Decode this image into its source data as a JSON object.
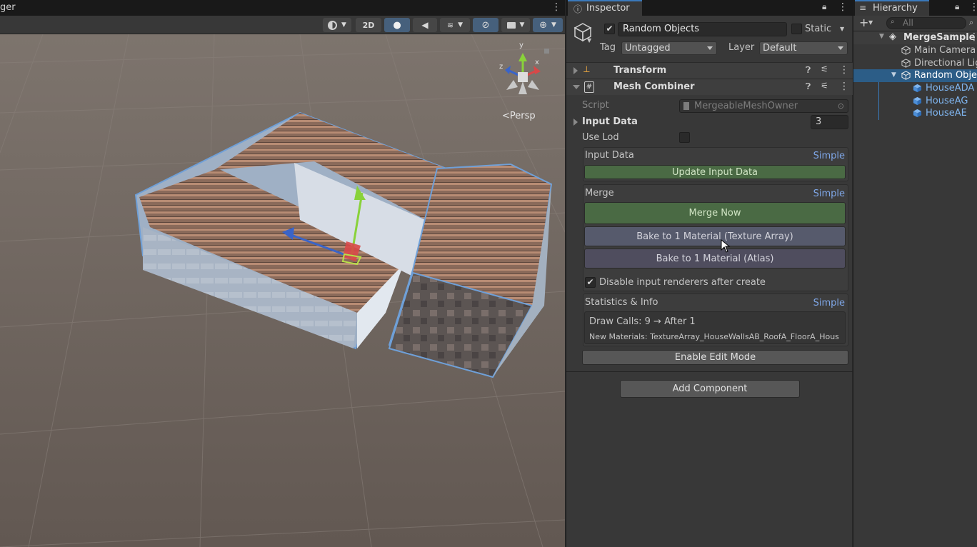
{
  "scene": {
    "tab_title": "ger",
    "toolbar": {
      "mode_2d": "2D"
    },
    "persp_label": "Persp",
    "gizmo_axes": {
      "y": "y",
      "x": "x",
      "z": "z"
    }
  },
  "inspector": {
    "tab_label": "Inspector",
    "object_name": "Random Objects",
    "active_checked": true,
    "static_label": "Static",
    "tag_label": "Tag",
    "tag_value": "Untagged",
    "layer_label": "Layer",
    "layer_value": "Default",
    "components": {
      "transform": "Transform",
      "mesh_combiner": "Mesh Combiner"
    },
    "script_label": "Script",
    "script_value": "MergeableMeshOwner",
    "input_data_label": "Input Data",
    "input_data_count": "3",
    "use_lod_label": "Use Lod",
    "sections": {
      "input_data": {
        "title": "Input Data",
        "simple": "Simple",
        "button": "Update Input Data"
      },
      "merge": {
        "title": "Merge",
        "simple": "Simple",
        "merge_now": "Merge Now",
        "bake_texture_array": "Bake to 1 Material (Texture Array)",
        "bake_atlas": "Bake to 1 Material (Atlas)",
        "disable_renderers": "Disable input renderers after create",
        "disable_renderers_checked": true
      },
      "stats": {
        "title": "Statistics & Info",
        "simple": "Simple",
        "draw_calls": "Draw Calls:  9  →  After  1",
        "new_materials": "New Materials:  TextureArray_HouseWallsAB_RoofA_FloorA_Hous"
      }
    },
    "enable_edit_mode": "Enable Edit Mode",
    "add_component": "Add Component"
  },
  "hierarchy": {
    "tab_label": "Hierarchy",
    "search_placeholder": "All",
    "scene_name": "MergeSample",
    "items": [
      {
        "label": "Main Camera"
      },
      {
        "label": "Directional Light"
      },
      {
        "label": "Random Objects"
      },
      {
        "label": "HouseADA"
      },
      {
        "label": "HouseAG"
      },
      {
        "label": "HouseAE"
      }
    ]
  },
  "colors": {
    "accent": "#3a79bb",
    "selection": "#2c5d87",
    "link_blue": "#7fa7e8",
    "green_button": "#4a6a44",
    "slate_button": "#565a6c"
  }
}
